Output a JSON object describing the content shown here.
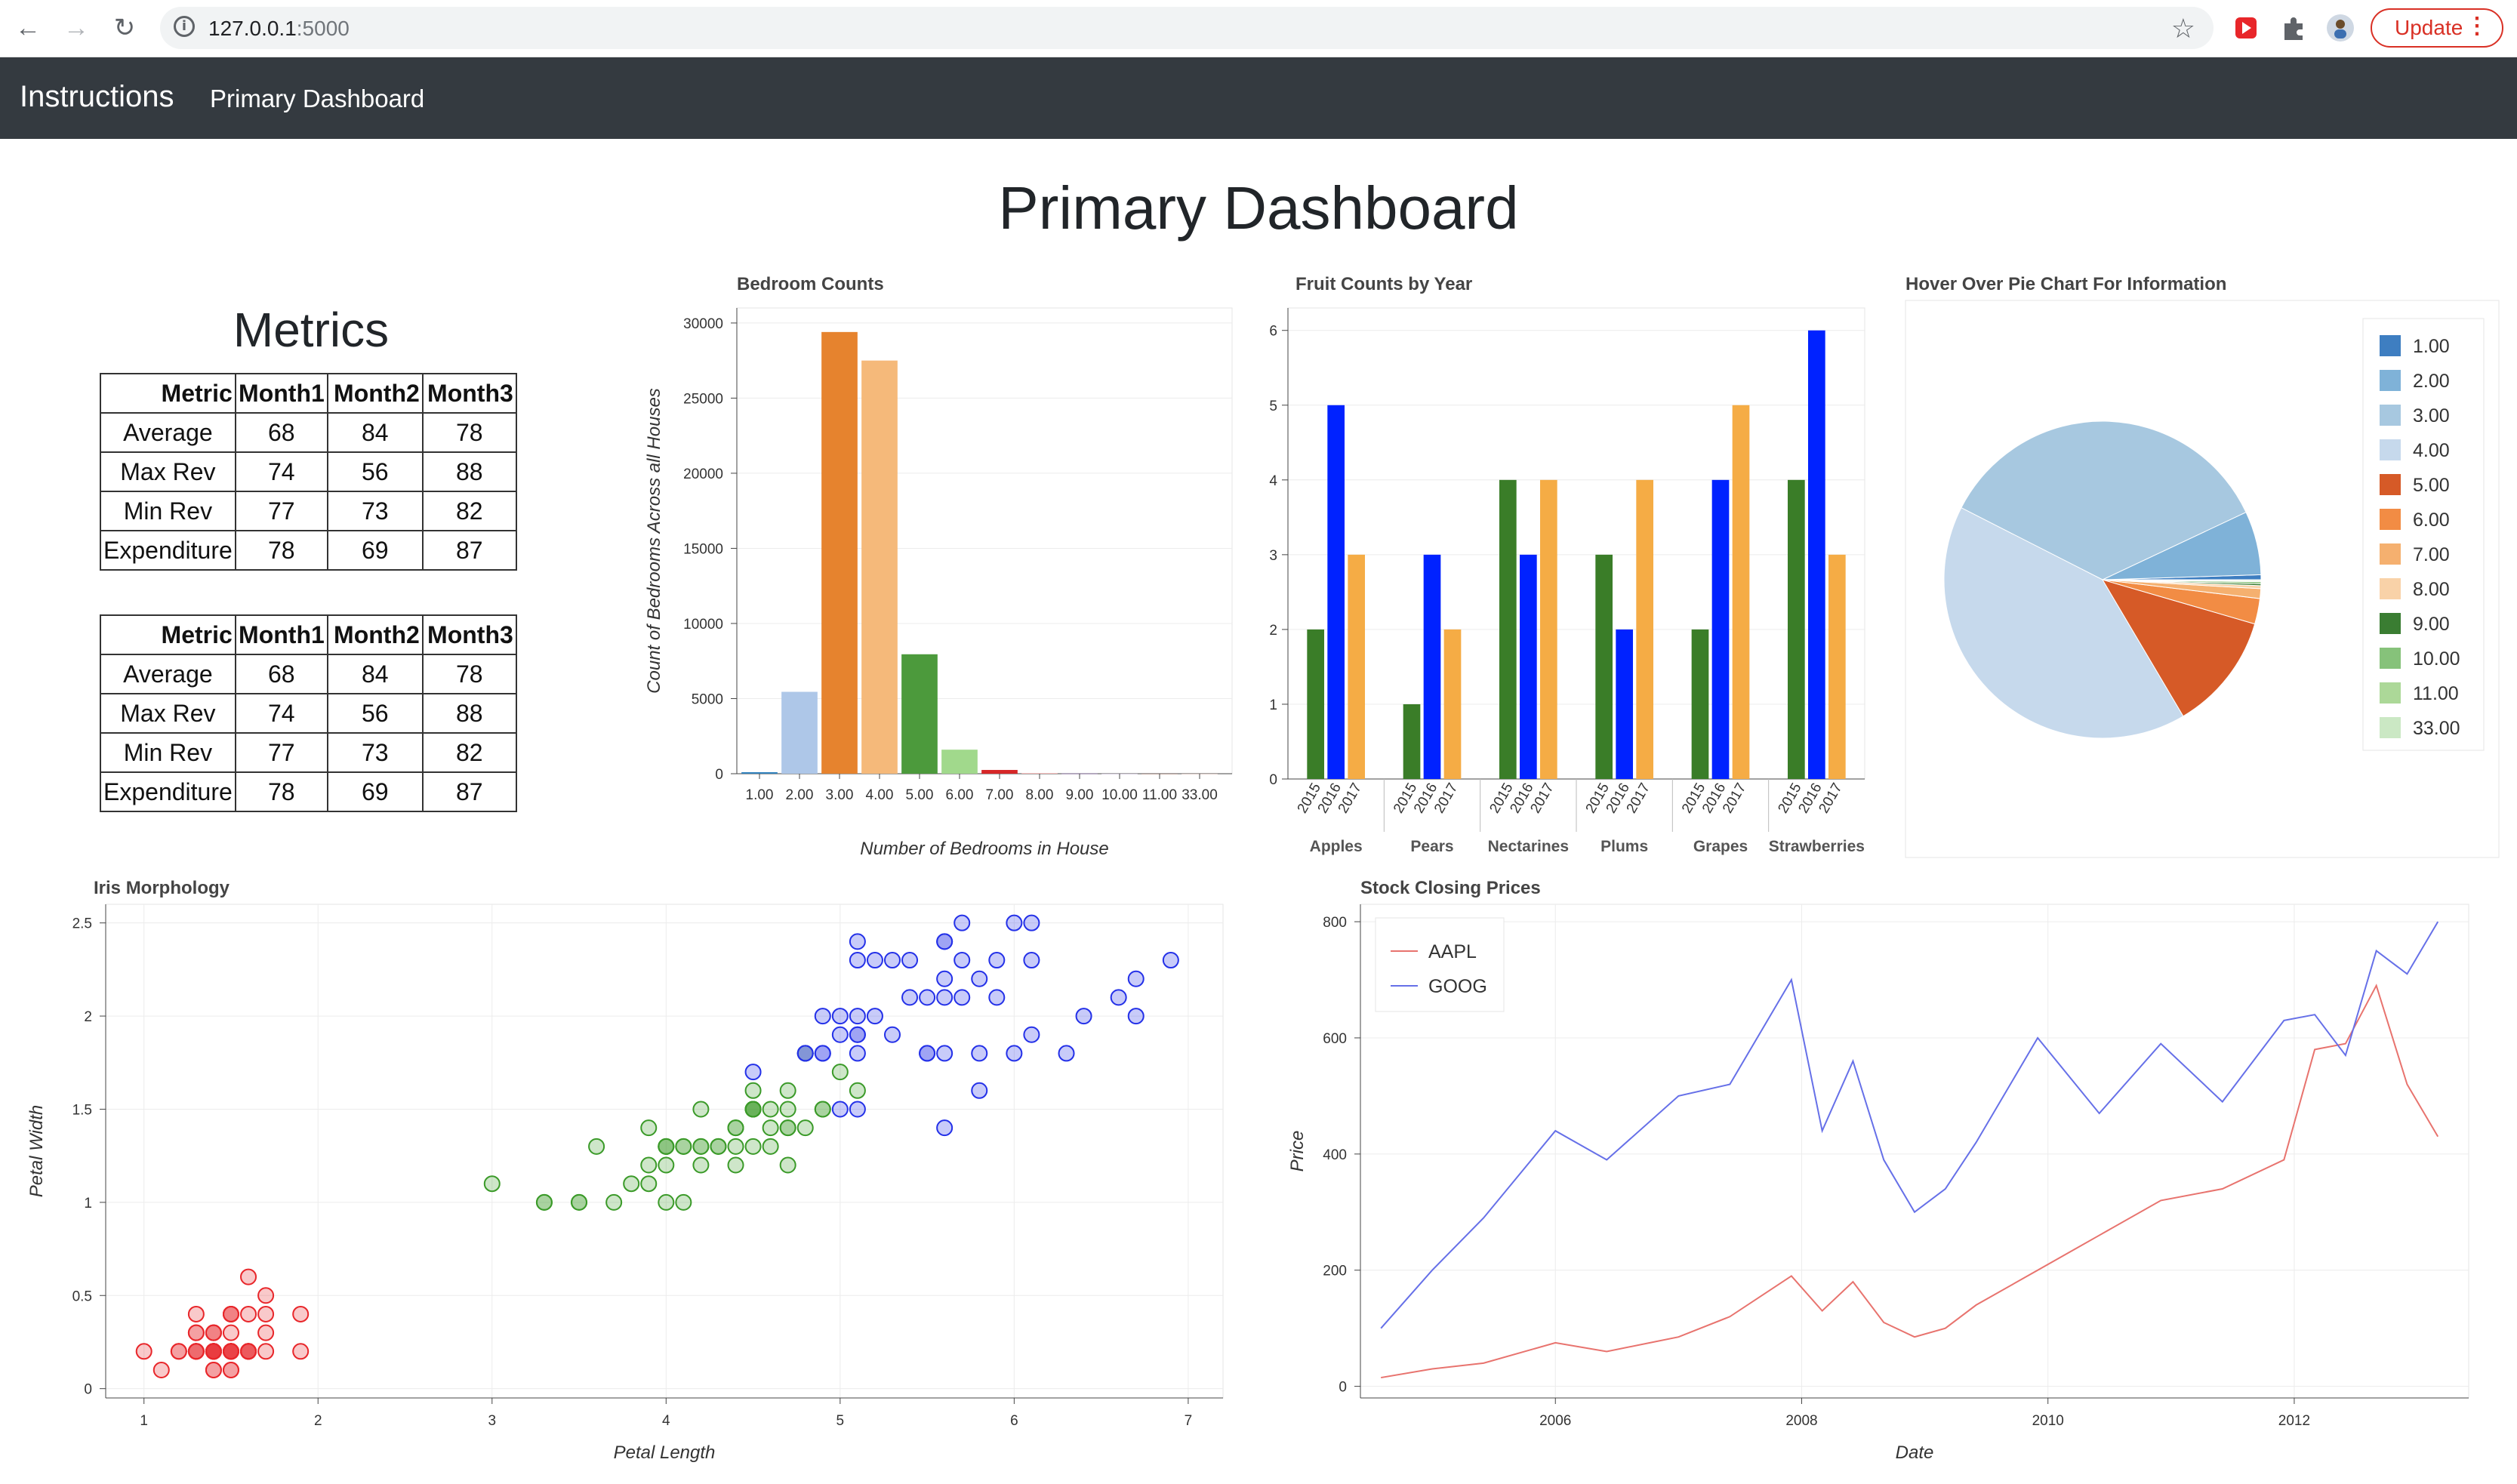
{
  "browser": {
    "url_host": "127.0.0.1",
    "url_port": ":5000",
    "update_label": "Update"
  },
  "navbar": {
    "brand": "Instructions",
    "link": "Primary Dashboard"
  },
  "page": {
    "title": "Primary Dashboard",
    "metrics_title": "Metrics"
  },
  "metrics": {
    "headers": [
      "Metric",
      "Month1",
      "Month2",
      "Month3"
    ],
    "rows": [
      [
        "Average",
        "68",
        "84",
        "78"
      ],
      [
        "Max Rev",
        "74",
        "56",
        "88"
      ],
      [
        "Min Rev",
        "77",
        "73",
        "82"
      ],
      [
        "Expenditure",
        "78",
        "69",
        "87"
      ]
    ]
  },
  "chart_data": [
    {
      "type": "bar",
      "title": "Bedroom Counts",
      "xlabel": "Number of Bedrooms in House",
      "ylabel": "Count of Bedrooms Across all Houses",
      "categories": [
        "1.00",
        "2.00",
        "3.00",
        "4.00",
        "5.00",
        "6.00",
        "7.00",
        "8.00",
        "9.00",
        "10.00",
        "11.00",
        "33.00"
      ],
      "values": [
        100,
        5450,
        29400,
        27500,
        7950,
        1600,
        250,
        30,
        10,
        3,
        1,
        1
      ],
      "colors": [
        "#3182bd",
        "#aec7e8",
        "#e6832e",
        "#f5b97a",
        "#4c9a3c",
        "#a1d98c",
        "#d62728",
        "#ff9896",
        "#9467bd",
        "#c5b0d5",
        "#8c564b",
        "#c49c94"
      ],
      "yticks": [
        0,
        5000,
        10000,
        15000,
        20000,
        25000,
        30000
      ],
      "ylim": [
        0,
        31000
      ]
    },
    {
      "type": "bar",
      "title": "Fruit Counts by Year",
      "groups": [
        "Apples",
        "Pears",
        "Nectarines",
        "Plums",
        "Grapes",
        "Strawberries"
      ],
      "subcategories": [
        "2015",
        "2016",
        "2017"
      ],
      "subcolors": [
        "#3a7d28",
        "#0022ff",
        "#f5ac45"
      ],
      "series": [
        {
          "values": [
            2,
            1,
            4,
            3,
            2,
            4
          ]
        },
        {
          "values": [
            5,
            3,
            3,
            2,
            4,
            6
          ]
        },
        {
          "values": [
            3,
            2,
            4,
            4,
            5,
            3
          ]
        }
      ],
      "yticks": [
        0,
        1,
        2,
        3,
        4,
        5,
        6
      ],
      "ylim": [
        0,
        6.3
      ]
    },
    {
      "type": "pie",
      "title": "Hover Over Pie Chart For Information",
      "labels": [
        "1.00",
        "2.00",
        "3.00",
        "4.00",
        "5.00",
        "6.00",
        "7.00",
        "8.00",
        "9.00",
        "10.00",
        "11.00",
        "33.00"
      ],
      "values": [
        0.5,
        6.5,
        35.5,
        41,
        12,
        2.6,
        1.0,
        0.3,
        0.2,
        0.2,
        0.1,
        0.1
      ],
      "colors": [
        "#3e7ec1",
        "#7fb2d8",
        "#a7c8e0",
        "#c6d9ec",
        "#d65a27",
        "#f28c44",
        "#f5b06f",
        "#f9d2a8",
        "#3a7d32",
        "#86c27a",
        "#acd898",
        "#cbe8c4"
      ],
      "legend_position": "top-right"
    },
    {
      "type": "scatter",
      "title": "Iris Morphology",
      "xlabel": "Petal Length",
      "ylabel": "Petal Width",
      "xticks": [
        1,
        2,
        3,
        4,
        5,
        6,
        7
      ],
      "yticks": [
        0,
        0.5,
        1,
        1.5,
        2,
        2.5
      ],
      "yticklabels": [
        "0",
        "0.5",
        "1",
        "1.5",
        "2",
        "2.5"
      ],
      "xlim": [
        0.78,
        7.2
      ],
      "ylim": [
        -0.05,
        2.6
      ],
      "grid": true,
      "series": [
        {
          "color": "#e8262a",
          "points": [
            [
              1.4,
              0.2
            ],
            [
              1.4,
              0.2
            ],
            [
              1.3,
              0.2
            ],
            [
              1.5,
              0.2
            ],
            [
              1.4,
              0.2
            ],
            [
              1.7,
              0.4
            ],
            [
              1.4,
              0.3
            ],
            [
              1.5,
              0.2
            ],
            [
              1.4,
              0.2
            ],
            [
              1.5,
              0.1
            ],
            [
              1.5,
              0.2
            ],
            [
              1.6,
              0.2
            ],
            [
              1.4,
              0.1
            ],
            [
              1.1,
              0.1
            ],
            [
              1.2,
              0.2
            ],
            [
              1.5,
              0.4
            ],
            [
              1.3,
              0.4
            ],
            [
              1.4,
              0.3
            ],
            [
              1.7,
              0.3
            ],
            [
              1.5,
              0.3
            ],
            [
              1.7,
              0.2
            ],
            [
              1.5,
              0.4
            ],
            [
              1.0,
              0.2
            ],
            [
              1.7,
              0.5
            ],
            [
              1.9,
              0.2
            ],
            [
              1.6,
              0.2
            ],
            [
              1.6,
              0.4
            ],
            [
              1.5,
              0.2
            ],
            [
              1.4,
              0.2
            ],
            [
              1.6,
              0.2
            ],
            [
              1.6,
              0.2
            ],
            [
              1.5,
              0.4
            ],
            [
              1.5,
              0.1
            ],
            [
              1.4,
              0.2
            ],
            [
              1.5,
              0.2
            ],
            [
              1.2,
              0.2
            ],
            [
              1.3,
              0.2
            ],
            [
              1.4,
              0.1
            ],
            [
              1.3,
              0.2
            ],
            [
              1.5,
              0.2
            ],
            [
              1.3,
              0.3
            ],
            [
              1.3,
              0.3
            ],
            [
              1.3,
              0.2
            ],
            [
              1.6,
              0.6
            ],
            [
              1.9,
              0.4
            ],
            [
              1.4,
              0.3
            ],
            [
              1.6,
              0.2
            ],
            [
              1.4,
              0.2
            ],
            [
              1.5,
              0.2
            ],
            [
              1.4,
              0.2
            ]
          ]
        },
        {
          "color": "#3a9a28",
          "points": [
            [
              4.7,
              1.4
            ],
            [
              4.5,
              1.5
            ],
            [
              4.9,
              1.5
            ],
            [
              4.0,
              1.3
            ],
            [
              4.6,
              1.5
            ],
            [
              4.5,
              1.3
            ],
            [
              4.7,
              1.6
            ],
            [
              3.3,
              1.0
            ],
            [
              4.6,
              1.3
            ],
            [
              3.9,
              1.4
            ],
            [
              3.5,
              1.0
            ],
            [
              4.2,
              1.5
            ],
            [
              4.0,
              1.0
            ],
            [
              4.7,
              1.4
            ],
            [
              3.6,
              1.3
            ],
            [
              4.4,
              1.4
            ],
            [
              4.5,
              1.5
            ],
            [
              4.1,
              1.0
            ],
            [
              4.5,
              1.5
            ],
            [
              3.9,
              1.1
            ],
            [
              4.8,
              1.8
            ],
            [
              4.0,
              1.3
            ],
            [
              4.9,
              1.5
            ],
            [
              4.7,
              1.2
            ],
            [
              4.3,
              1.3
            ],
            [
              4.4,
              1.4
            ],
            [
              4.8,
              1.4
            ],
            [
              5.0,
              1.7
            ],
            [
              4.5,
              1.5
            ],
            [
              3.5,
              1.0
            ],
            [
              3.8,
              1.1
            ],
            [
              3.7,
              1.0
            ],
            [
              3.9,
              1.2
            ],
            [
              5.1,
              1.6
            ],
            [
              4.5,
              1.5
            ],
            [
              4.5,
              1.6
            ],
            [
              4.7,
              1.5
            ],
            [
              4.4,
              1.3
            ],
            [
              4.1,
              1.3
            ],
            [
              4.0,
              1.3
            ],
            [
              4.4,
              1.2
            ],
            [
              4.6,
              1.4
            ],
            [
              4.0,
              1.2
            ],
            [
              3.3,
              1.0
            ],
            [
              4.2,
              1.3
            ],
            [
              4.2,
              1.2
            ],
            [
              4.2,
              1.3
            ],
            [
              4.3,
              1.3
            ],
            [
              3.0,
              1.1
            ],
            [
              4.1,
              1.3
            ]
          ]
        },
        {
          "color": "#2330e8",
          "points": [
            [
              6.0,
              2.5
            ],
            [
              5.1,
              1.9
            ],
            [
              5.9,
              2.1
            ],
            [
              5.6,
              1.8
            ],
            [
              5.8,
              2.2
            ],
            [
              6.6,
              2.1
            ],
            [
              4.5,
              1.7
            ],
            [
              6.3,
              1.8
            ],
            [
              5.8,
              1.8
            ],
            [
              6.1,
              2.5
            ],
            [
              5.1,
              2.0
            ],
            [
              5.3,
              1.9
            ],
            [
              5.5,
              2.1
            ],
            [
              5.0,
              2.0
            ],
            [
              5.1,
              2.4
            ],
            [
              5.3,
              2.3
            ],
            [
              5.5,
              1.8
            ],
            [
              6.7,
              2.2
            ],
            [
              6.9,
              2.3
            ],
            [
              5.0,
              1.5
            ],
            [
              5.7,
              2.3
            ],
            [
              4.9,
              2.0
            ],
            [
              6.7,
              2.0
            ],
            [
              4.9,
              1.8
            ],
            [
              5.7,
              2.1
            ],
            [
              6.0,
              1.8
            ],
            [
              4.8,
              1.8
            ],
            [
              4.9,
              1.8
            ],
            [
              5.6,
              2.1
            ],
            [
              5.8,
              1.6
            ],
            [
              6.1,
              1.9
            ],
            [
              6.4,
              2.0
            ],
            [
              5.6,
              2.2
            ],
            [
              5.1,
              1.5
            ],
            [
              5.6,
              1.4
            ],
            [
              6.1,
              2.3
            ],
            [
              5.6,
              2.4
            ],
            [
              5.5,
              1.8
            ],
            [
              4.8,
              1.8
            ],
            [
              5.4,
              2.1
            ],
            [
              5.6,
              2.4
            ],
            [
              5.1,
              2.3
            ],
            [
              5.1,
              1.9
            ],
            [
              5.9,
              2.3
            ],
            [
              5.7,
              2.5
            ],
            [
              5.2,
              2.3
            ],
            [
              5.0,
              1.9
            ],
            [
              5.2,
              2.0
            ],
            [
              5.4,
              2.3
            ],
            [
              5.1,
              1.8
            ]
          ]
        }
      ]
    },
    {
      "type": "line",
      "title": "Stock Closing Prices",
      "xlabel": "Date",
      "ylabel": "Price",
      "xticks": [
        "2006",
        "2008",
        "2010",
        "2012"
      ],
      "yticks": [
        0,
        200,
        400,
        600,
        800
      ],
      "xlim": [
        "2004-06",
        "2013-06"
      ],
      "ylim": [
        -20,
        830
      ],
      "grid": true,
      "legend_position": "top-left",
      "series": [
        {
          "name": "AAPL",
          "color": "#e8736e",
          "x": [
            "2004-08",
            "2005-01",
            "2005-06",
            "2006-01",
            "2006-06",
            "2007-01",
            "2007-06",
            "2007-12",
            "2008-03",
            "2008-06",
            "2008-09",
            "2008-12",
            "2009-03",
            "2009-06",
            "2009-12",
            "2010-06",
            "2010-12",
            "2011-06",
            "2011-12",
            "2012-03",
            "2012-06",
            "2012-09",
            "2012-12",
            "2013-03"
          ],
          "y": [
            15,
            30,
            40,
            75,
            60,
            85,
            120,
            190,
            130,
            180,
            110,
            85,
            100,
            140,
            200,
            260,
            320,
            340,
            390,
            580,
            590,
            690,
            520,
            430
          ]
        },
        {
          "name": "GOOG",
          "color": "#6670e8",
          "x": [
            "2004-08",
            "2005-01",
            "2005-06",
            "2006-01",
            "2006-06",
            "2007-01",
            "2007-06",
            "2007-12",
            "2008-03",
            "2008-06",
            "2008-09",
            "2008-12",
            "2009-03",
            "2009-06",
            "2009-12",
            "2010-06",
            "2010-12",
            "2011-06",
            "2011-12",
            "2012-03",
            "2012-06",
            "2012-09",
            "2012-12",
            "2013-03"
          ],
          "y": [
            100,
            200,
            290,
            440,
            390,
            500,
            520,
            700,
            440,
            560,
            390,
            300,
            340,
            420,
            600,
            470,
            590,
            490,
            630,
            640,
            570,
            750,
            710,
            800
          ]
        }
      ]
    }
  ]
}
